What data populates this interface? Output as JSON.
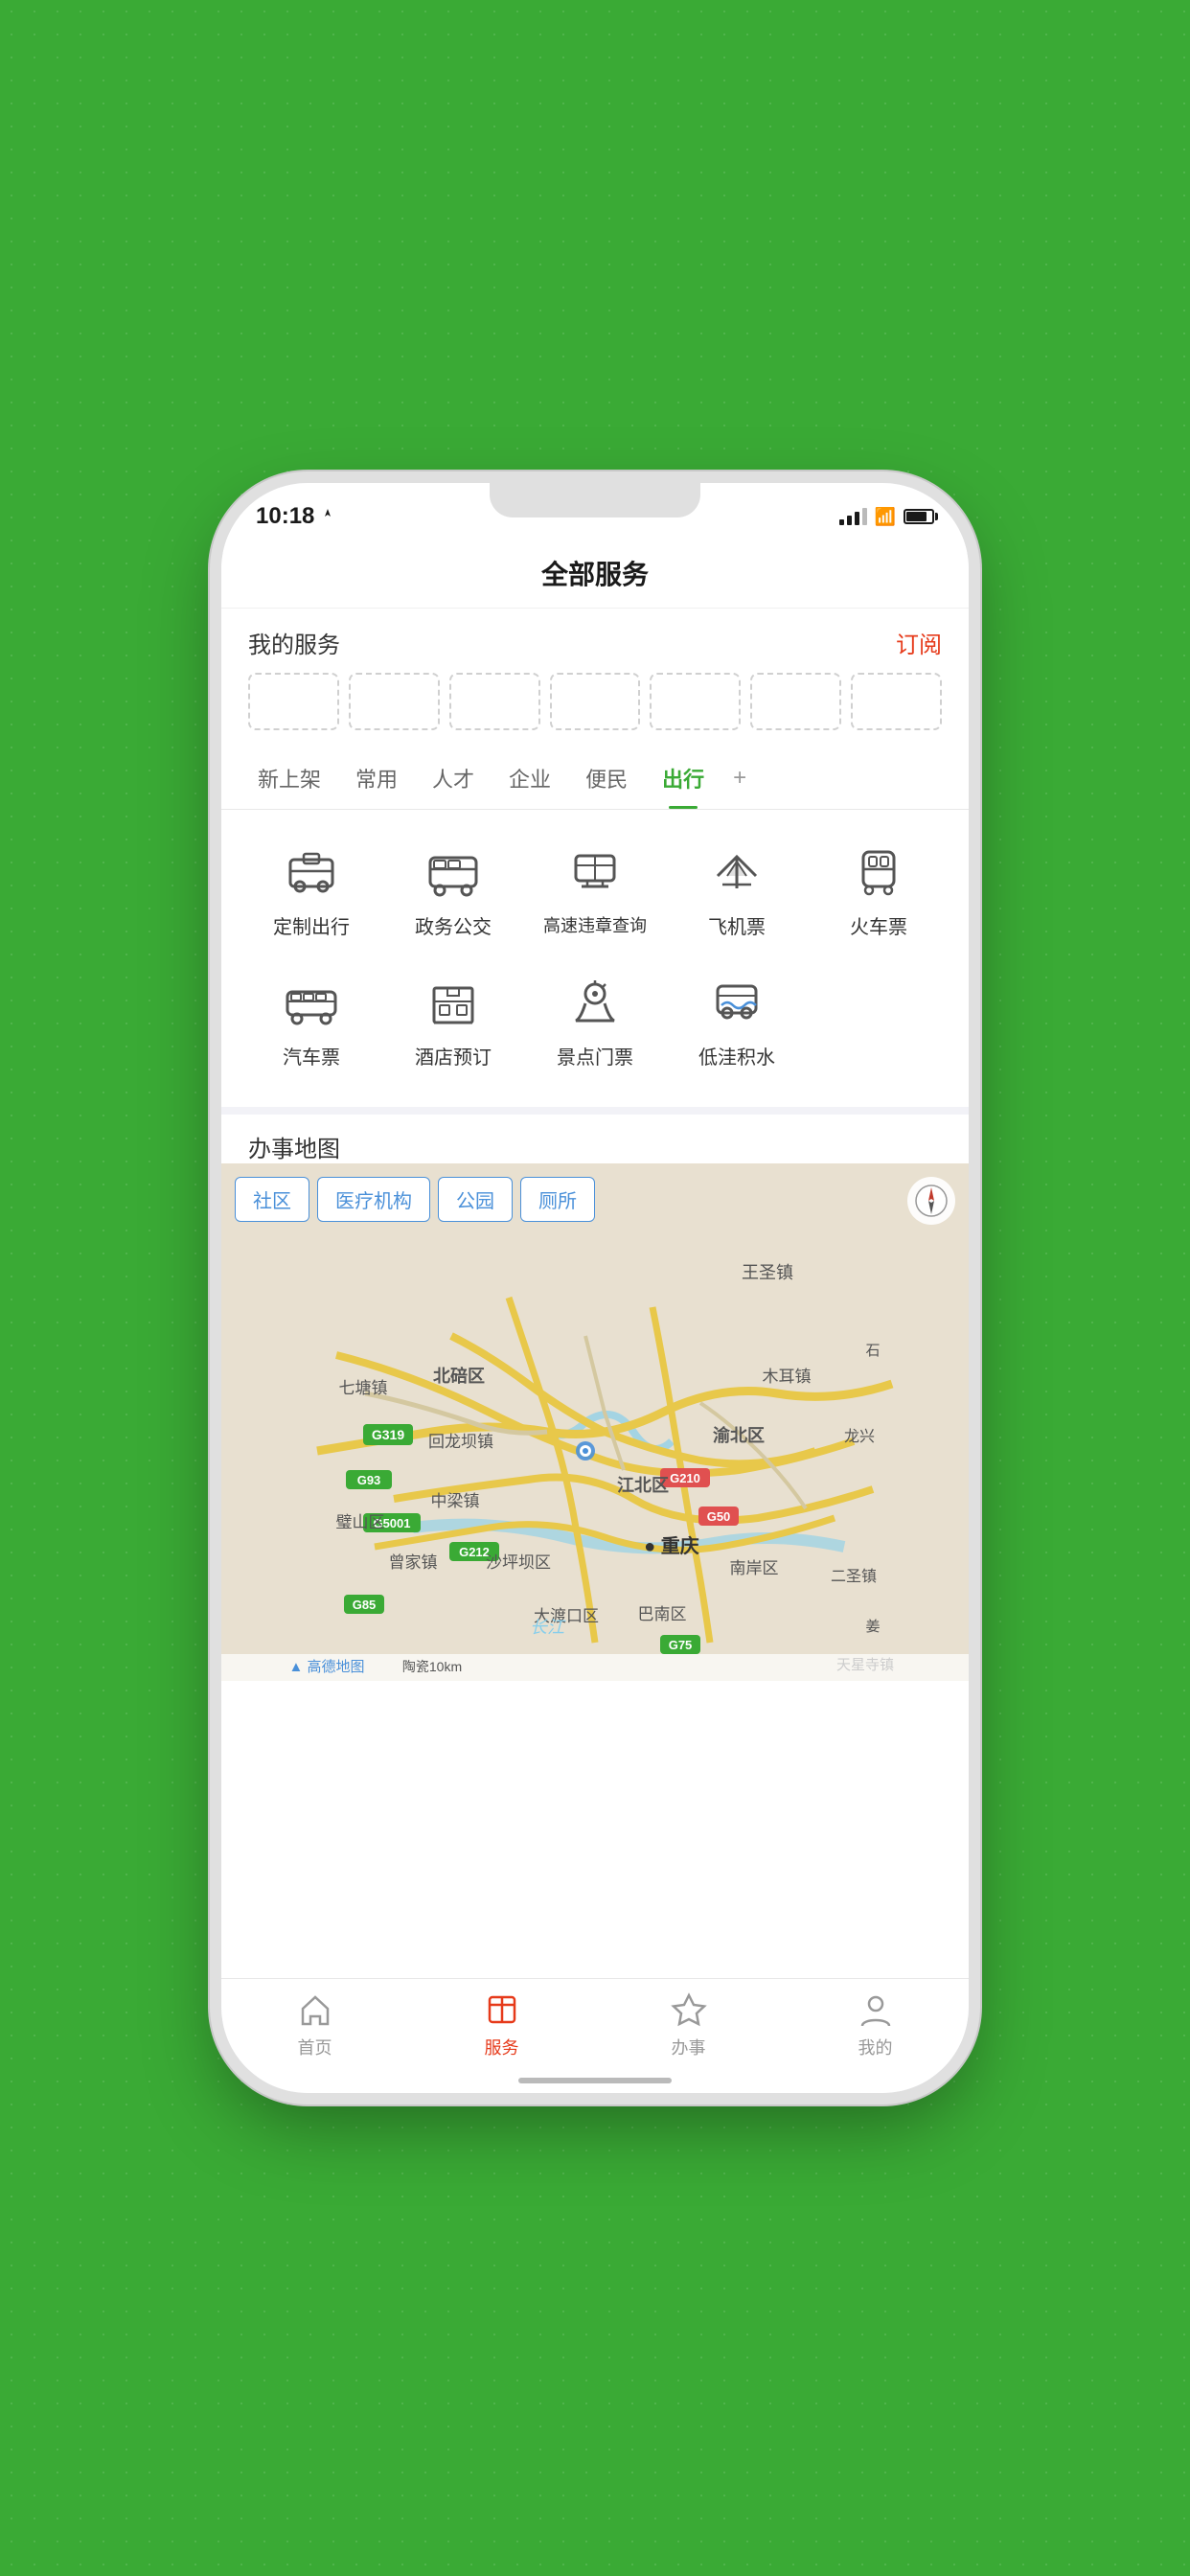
{
  "app": {
    "title": "全部服务"
  },
  "status_bar": {
    "time": "10:18",
    "location_icon": "location-arrow"
  },
  "my_services": {
    "label": "我的服务",
    "subscribe": "订阅"
  },
  "tabs": [
    {
      "id": "new",
      "label": "新上架",
      "active": false
    },
    {
      "id": "common",
      "label": "常用",
      "active": false
    },
    {
      "id": "talent",
      "label": "人才",
      "active": false
    },
    {
      "id": "enterprise",
      "label": "企业",
      "active": false
    },
    {
      "id": "convenience",
      "label": "便民",
      "active": false
    },
    {
      "id": "travel",
      "label": "出行",
      "active": true
    }
  ],
  "services_row1": [
    {
      "icon": "custom-trip",
      "label": "定制出行"
    },
    {
      "icon": "bus",
      "label": "政务公交"
    },
    {
      "icon": "highway",
      "label": "高速违章查询"
    },
    {
      "icon": "plane",
      "label": "飞机票"
    },
    {
      "icon": "train",
      "label": "火车票"
    }
  ],
  "services_row2": [
    {
      "icon": "coach",
      "label": "汽车票"
    },
    {
      "icon": "hotel",
      "label": "酒店预订"
    },
    {
      "icon": "scenic",
      "label": "景点门票"
    },
    {
      "icon": "flood",
      "label": "低洼积水"
    }
  ],
  "map_section": {
    "title": "办事地图",
    "filters": [
      "社区",
      "医疗机构",
      "公园",
      "厕所"
    ],
    "map_labels": [
      "王圣镇",
      "七塘镇",
      "北碚区",
      "木耳镇",
      "回龙坝镇",
      "渝北区",
      "中梁镇",
      "江北区",
      "壁山区",
      "曾家镇",
      "沙坪坝区",
      "重庆",
      "大渡口区",
      "南岸区",
      "巴南区",
      "二圣镇",
      "长江",
      "高德地图",
      "陶瓷10km",
      "G319",
      "G93",
      "G5001",
      "G212",
      "G210",
      "G50",
      "G85",
      "G75"
    ]
  },
  "bottom_nav": [
    {
      "id": "home",
      "label": "首页",
      "active": false
    },
    {
      "id": "services",
      "label": "服务",
      "active": true
    },
    {
      "id": "tasks",
      "label": "办事",
      "active": false
    },
    {
      "id": "profile",
      "label": "我的",
      "active": false
    }
  ]
}
